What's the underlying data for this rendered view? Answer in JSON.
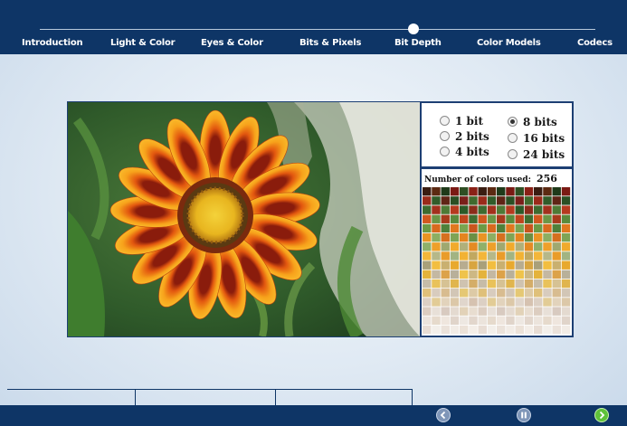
{
  "nav": {
    "items": [
      {
        "label": "Introduction"
      },
      {
        "label": "Light & Color"
      },
      {
        "label": "Eyes & Color"
      },
      {
        "label": "Bits & Pixels"
      },
      {
        "label": "Bit Depth"
      },
      {
        "label": "Color Models"
      },
      {
        "label": "Codecs"
      }
    ],
    "active": "Bit Depth"
  },
  "options": {
    "items": [
      {
        "label": "1 bit",
        "selected": false
      },
      {
        "label": "2 bits",
        "selected": false
      },
      {
        "label": "4 bits",
        "selected": false
      },
      {
        "label": "8 bits",
        "selected": true
      },
      {
        "label": "16 bits",
        "selected": false
      },
      {
        "label": "24 bits",
        "selected": false
      }
    ]
  },
  "colors": {
    "label": "Number of colors used:",
    "count": "256"
  },
  "theme": {
    "nav_bg": "#0e3566",
    "control_active": "#5fc23a",
    "control_inactive": "#7f96b8"
  },
  "controls": {
    "back_icon": "chevron-left-icon",
    "pause_icon": "pause-icon",
    "next_icon": "chevron-right-icon"
  }
}
